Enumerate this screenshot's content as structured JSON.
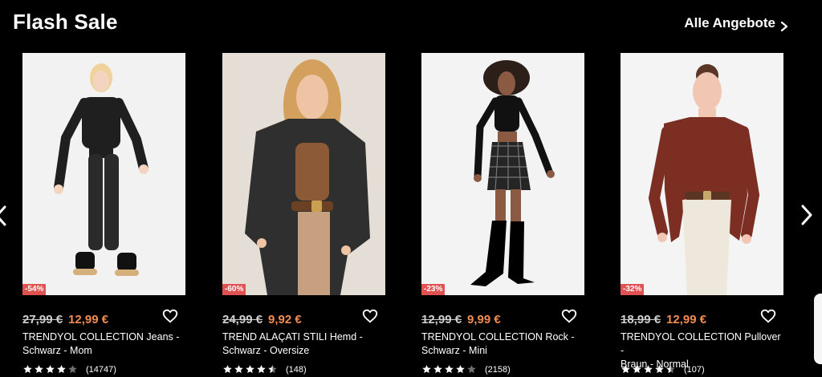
{
  "header": {
    "title": "Flash Sale",
    "all_offers_label": "Alle Angebote"
  },
  "icons": {
    "chevron_right": "chevron-right-icon",
    "chevron_left": "chevron-left-icon",
    "heart": "heart-icon",
    "star": "star-icon"
  },
  "colors": {
    "background": "#000000",
    "discount_badge": "#e05252",
    "sale_price": "#f28c51",
    "text": "#ffffff"
  },
  "products": [
    {
      "discount": "-54%",
      "old_price": "27,99 €",
      "new_price": "12,99 €",
      "title_line_1": "TRENDYOL COLLECTION Jeans -",
      "title_line_2": "Schwarz - Mom",
      "rating_count": "(14747)",
      "rating_value": 4
    },
    {
      "discount": "-60%",
      "old_price": "24,99 €",
      "new_price": "9,92 €",
      "title_line_1": "TREND ALAÇATI STILI Hemd -",
      "title_line_2": "Schwarz - Oversize",
      "rating_count": "(148)",
      "rating_value": 4.5
    },
    {
      "discount": "-23%",
      "old_price": "12,99 €",
      "new_price": "9,99 €",
      "title_line_1": "TRENDYOL COLLECTION Rock -",
      "title_line_2": "Schwarz - Mini",
      "rating_count": "(2158)",
      "rating_value": 4
    },
    {
      "discount": "-32%",
      "old_price": "18,99 €",
      "new_price": "12,99 €",
      "title_line_1": "TRENDYOL COLLECTION Pullover -",
      "title_line_2": "Braun - Normal",
      "rating_count": "(107)",
      "rating_value": 4.5
    }
  ]
}
